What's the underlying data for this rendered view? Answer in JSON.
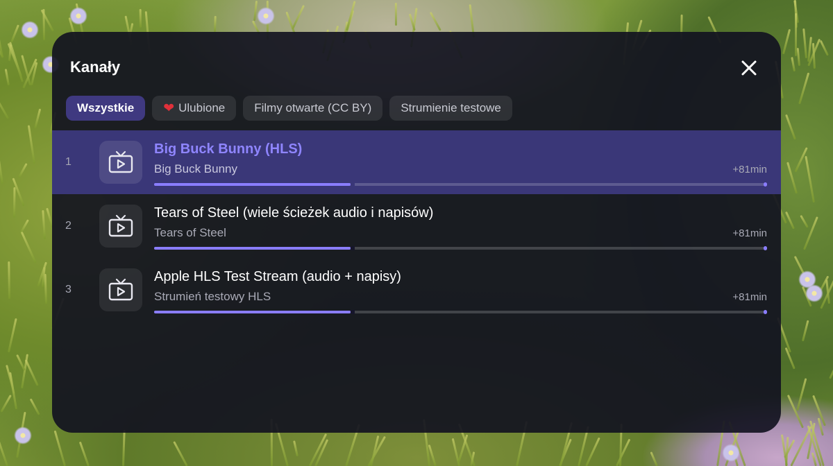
{
  "dialog": {
    "title": "Kanały",
    "close_icon": "close-icon"
  },
  "tabs": [
    {
      "label": "Wszystkie",
      "active": true,
      "icon": null
    },
    {
      "label": "Ulubione",
      "active": false,
      "icon": "heart-icon"
    },
    {
      "label": "Filmy otwarte (CC BY)",
      "active": false,
      "icon": null
    },
    {
      "label": "Strumienie testowe",
      "active": false,
      "icon": null
    }
  ],
  "channels": [
    {
      "number": "1",
      "title": "Big Buck Bunny (HLS)",
      "subtitle": "Big Buck Bunny",
      "duration": "+81min",
      "progress": 0.32,
      "selected": true,
      "icon": "tv-icon"
    },
    {
      "number": "2",
      "title": "Tears of Steel (wiele ścieżek audio i napisów)",
      "subtitle": "Tears of Steel",
      "duration": "+81min",
      "progress": 0.32,
      "selected": false,
      "icon": "tv-icon"
    },
    {
      "number": "3",
      "title": "Apple HLS Test Stream (audio + napisy)",
      "subtitle": "Strumień testowy HLS",
      "duration": "+81min",
      "progress": 0.32,
      "selected": false,
      "icon": "tv-icon"
    }
  ],
  "colors": {
    "accent": "#8a7dff",
    "selected_row": "#3a3778",
    "active_tab": "#3f3980",
    "heart": "#e0303a"
  }
}
